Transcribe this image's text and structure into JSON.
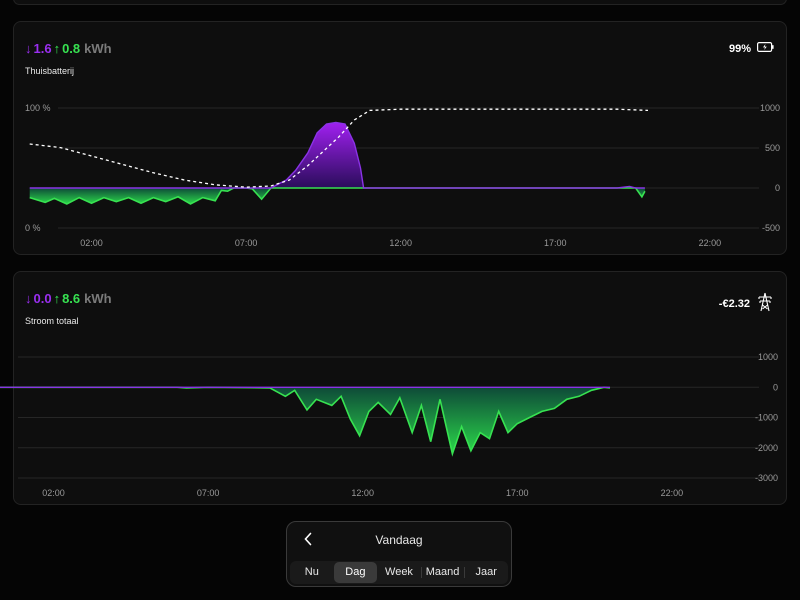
{
  "battery": {
    "in_kwh": "1.6",
    "out_kwh": "0.8",
    "unit": "kWh",
    "title": "Thuisbatterij",
    "soc": "99%",
    "icon": "battery-icon",
    "colors": {
      "import": "#9a2ff0",
      "export": "#37e251"
    },
    "chart_data": {
      "type": "area",
      "x_ticks": [
        "02:00",
        "07:00",
        "12:00",
        "17:00",
        "22:00"
      ],
      "x_tick_hours": [
        2,
        7,
        12,
        17,
        22
      ],
      "y_ticks_left": [
        "100 %",
        "0 %"
      ],
      "y_ticks_right": [
        "1000",
        "500",
        "0",
        "-500"
      ],
      "x_range_hours": [
        0,
        24
      ],
      "y_range_power": [
        -500,
        1000
      ],
      "y_range_soc_percent": [
        0,
        100
      ],
      "grid": true,
      "series": [
        {
          "kind": "power",
          "points": [
            [
              0,
              -120
            ],
            [
              0.5,
              -180
            ],
            [
              0.8,
              -130
            ],
            [
              1.2,
              -200
            ],
            [
              1.6,
              -120
            ],
            [
              2.0,
              -190
            ],
            [
              2.4,
              -120
            ],
            [
              2.8,
              -170
            ],
            [
              3.2,
              -120
            ],
            [
              3.6,
              -190
            ],
            [
              4.0,
              -120
            ],
            [
              4.4,
              -170
            ],
            [
              4.8,
              -110
            ],
            [
              5.2,
              -200
            ],
            [
              5.6,
              -120
            ],
            [
              6.0,
              -160
            ],
            [
              6.2,
              -30
            ],
            [
              6.4,
              -40
            ],
            [
              6.6,
              0
            ],
            [
              7.0,
              0
            ],
            [
              7.2,
              -10
            ],
            [
              7.5,
              -140
            ],
            [
              7.8,
              0
            ],
            [
              8.0,
              40
            ],
            [
              8.3,
              100
            ],
            [
              8.6,
              220
            ],
            [
              9.0,
              440
            ],
            [
              9.3,
              690
            ],
            [
              9.6,
              800
            ],
            [
              9.9,
              820
            ],
            [
              10.2,
              800
            ],
            [
              10.5,
              560
            ],
            [
              10.7,
              250
            ],
            [
              10.8,
              0
            ],
            [
              19.0,
              0
            ],
            [
              19.4,
              20
            ],
            [
              19.6,
              0
            ],
            [
              19.8,
              -110
            ],
            [
              19.9,
              -40
            ]
          ]
        },
        {
          "kind": "soc",
          "points": [
            [
              0,
              70
            ],
            [
              1,
              67
            ],
            [
              2,
              60
            ],
            [
              3,
              53
            ],
            [
              4,
              46
            ],
            [
              5,
              40
            ],
            [
              6,
              36
            ],
            [
              7,
              34
            ],
            [
              7.8,
              35
            ],
            [
              8.4,
              40
            ],
            [
              9.0,
              52
            ],
            [
              9.5,
              64
            ],
            [
              10.0,
              76
            ],
            [
              10.5,
              90
            ],
            [
              11.0,
              98
            ],
            [
              12,
              99
            ],
            [
              14,
              99
            ],
            [
              17,
              99
            ],
            [
              19,
              99
            ],
            [
              20,
              98
            ]
          ]
        }
      ]
    }
  },
  "grid_power": {
    "in_kwh": "0.0",
    "out_kwh": "8.6",
    "unit": "kWh",
    "title": "Stroom totaal",
    "cost": "-€2.32",
    "icon": "power-pylon-icon",
    "chart_data": {
      "type": "area",
      "x_ticks": [
        "02:00",
        "07:00",
        "12:00",
        "17:00",
        "22:00"
      ],
      "x_tick_hours": [
        2,
        7,
        12,
        17,
        22
      ],
      "y_ticks_right": [
        "1000",
        "0",
        "-1000",
        "-2000",
        "-3000"
      ],
      "x_range_hours": [
        0,
        24
      ],
      "y_range_power": [
        -3000,
        1000
      ],
      "grid": true,
      "series": [
        {
          "kind": "power",
          "points": [
            [
              0,
              0
            ],
            [
              6.0,
              0
            ],
            [
              6.3,
              -20
            ],
            [
              7.0,
              0
            ],
            [
              9.0,
              -20
            ],
            [
              9.5,
              -300
            ],
            [
              9.8,
              -100
            ],
            [
              10.2,
              -750
            ],
            [
              10.5,
              -400
            ],
            [
              11.0,
              -600
            ],
            [
              11.3,
              -300
            ],
            [
              11.6,
              -1050
            ],
            [
              11.9,
              -1600
            ],
            [
              12.2,
              -800
            ],
            [
              12.5,
              -500
            ],
            [
              12.9,
              -900
            ],
            [
              13.2,
              -350
            ],
            [
              13.6,
              -1500
            ],
            [
              13.9,
              -600
            ],
            [
              14.2,
              -1800
            ],
            [
              14.5,
              -400
            ],
            [
              14.9,
              -2200
            ],
            [
              15.2,
              -1300
            ],
            [
              15.5,
              -2100
            ],
            [
              15.8,
              -1500
            ],
            [
              16.1,
              -1700
            ],
            [
              16.4,
              -800
            ],
            [
              16.7,
              -1500
            ],
            [
              17.0,
              -1200
            ],
            [
              17.4,
              -1000
            ],
            [
              17.8,
              -800
            ],
            [
              18.2,
              -700
            ],
            [
              18.6,
              -400
            ],
            [
              19.0,
              -300
            ],
            [
              19.4,
              -100
            ],
            [
              19.8,
              0
            ],
            [
              20,
              -20
            ]
          ]
        }
      ]
    }
  },
  "nav": {
    "title": "Vandaag",
    "tabs": [
      "Nu",
      "Dag",
      "Week",
      "Maand",
      "Jaar"
    ],
    "active_tab": "Dag"
  }
}
